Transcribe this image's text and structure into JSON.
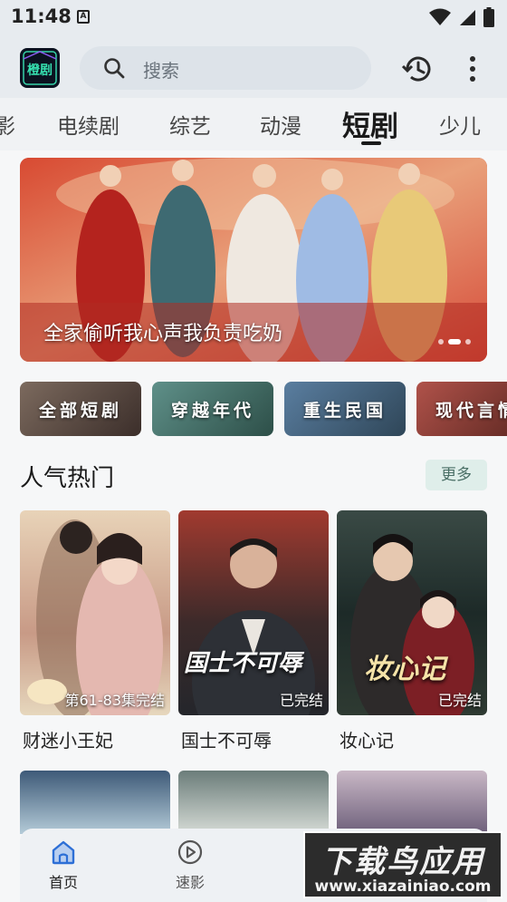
{
  "status_bar": {
    "time": "11:48",
    "notification_letter": "A"
  },
  "header": {
    "search_placeholder": "搜索",
    "logo_text": "橙剧"
  },
  "tabs": [
    {
      "label": "影",
      "active": false
    },
    {
      "label": "电续剧",
      "active": false
    },
    {
      "label": "综艺",
      "active": false
    },
    {
      "label": "动漫",
      "active": false
    },
    {
      "label": "短剧",
      "active": true
    },
    {
      "label": "少儿",
      "active": false
    }
  ],
  "banner": {
    "title": "全家偷听我心声我负责吃奶",
    "slides_total": 3,
    "active_slide": 2
  },
  "categories": [
    {
      "label": "全部短剧"
    },
    {
      "label": "穿越年代"
    },
    {
      "label": "重生民国"
    },
    {
      "label": "现代言情"
    }
  ],
  "section": {
    "title": "人气热门",
    "more_label": "更多"
  },
  "cards": [
    {
      "title": "财迷小王妃",
      "badge": "第61-83集完结",
      "poster_text": ""
    },
    {
      "title": "国士不可辱",
      "badge": "已完结",
      "poster_text": "国士不可辱"
    },
    {
      "title": "妆心记",
      "badge": "已完结",
      "poster_text": "妆心记"
    }
  ],
  "bottom_nav": [
    {
      "label": "首页",
      "icon": "home-icon",
      "active": true
    },
    {
      "label": "速影",
      "icon": "play-circle-icon",
      "active": false
    }
  ],
  "watermark": {
    "brand": "下载鸟应用",
    "url": "www.xiazainiao.com"
  },
  "colors": {
    "background": "#f6f7f8",
    "header": "#e7ebef",
    "active_nav": "#2d6fd6",
    "more_bg": "#dfeeea"
  }
}
